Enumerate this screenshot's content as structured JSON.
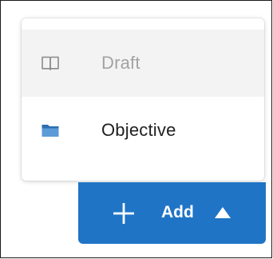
{
  "menu": {
    "items": [
      {
        "label": "Draft",
        "icon": "book-icon",
        "state": "disabled"
      },
      {
        "label": "Objective",
        "icon": "folder-icon",
        "state": "enabled"
      }
    ]
  },
  "add_button": {
    "label": "Add",
    "icon": "plus-icon",
    "caret": "caret-up-icon"
  },
  "colors": {
    "accent": "#1f74c6",
    "folder": "#4a8fd1",
    "disabled_text": "#a3a3a3",
    "highlight_bg": "#f3f3f3"
  }
}
